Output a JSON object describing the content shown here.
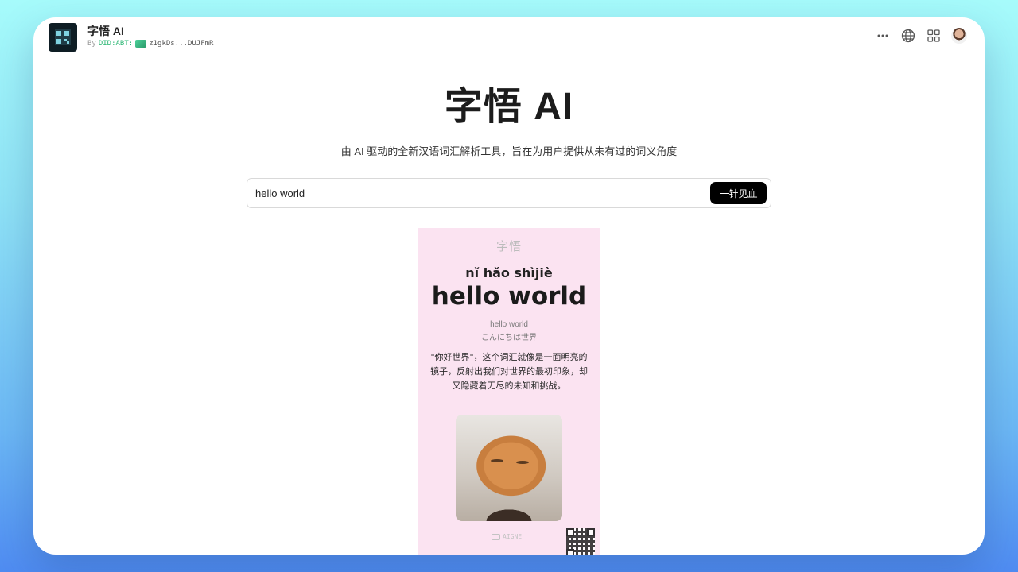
{
  "app": {
    "title": "字悟 AI",
    "author_prefix": "By",
    "did_prefix": "DID:ABT:",
    "did_address": "z1gkDs...DUJFmR"
  },
  "header_icons": [
    "more-icon",
    "globe-icon",
    "apps-grid-icon",
    "user-avatar"
  ],
  "main": {
    "title": "字悟 AI",
    "subtitle": "由 AI 驱动的全新汉语词汇解析工具，旨在为用户提供从未有过的词义角度"
  },
  "search": {
    "value": "hello world",
    "submit_label": "一针见血"
  },
  "card": {
    "brand": "字悟",
    "pinyin": "nǐ hǎo shìjiè",
    "word": "hello world",
    "english": "hello world",
    "japanese": "こんにちは世界",
    "description": "\"你好世界\"，这个词汇就像是一面明亮的镜子，反射出我们对世界的最初印象，却又隐藏着无尽的未知和挑战。",
    "footer": "AIGNE"
  },
  "colors": {
    "card_background": "#fbe3f1",
    "button": "#000000",
    "did_green": "#2bb673"
  }
}
